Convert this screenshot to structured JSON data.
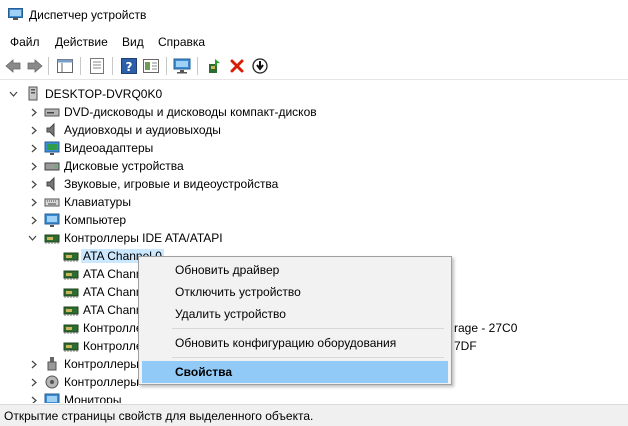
{
  "window": {
    "title": "Диспетчер устройств"
  },
  "menu": {
    "items": [
      "Файл",
      "Действие",
      "Вид",
      "Справка"
    ]
  },
  "toolbar": {
    "buttons": [
      "back-icon",
      "forward-icon",
      "view-icon",
      "properties-icon",
      "help-icon",
      "view-resources-icon",
      "monitor-icon",
      "update-driver-icon",
      "uninstall-icon",
      "disable-icon"
    ]
  },
  "tree": {
    "root": "DESKTOP-DVRQ0K0",
    "categories": [
      "DVD-дисководы и дисководы компакт-дисков",
      "Аудиовходы и аудиовыходы",
      "Видеоадаптеры",
      "Дисковые устройства",
      "Звуковые, игровые и видеоустройства",
      "Клавиатуры",
      "Компьютер",
      "Контроллеры IDE ATA/ATAPI"
    ],
    "ide_children": [
      "ATA Channel 0",
      "ATA Chann",
      "ATA Chann",
      "ATA Chann",
      "Контролле",
      "Контролле"
    ],
    "ide_child_right_parts": [
      "rage - 27C0",
      "7DF"
    ],
    "after": [
      "Контроллеры",
      "Контроллеры",
      "Мониторы"
    ]
  },
  "context_menu": {
    "items": [
      "Обновить драйвер",
      "Отключить устройство",
      "Удалить устройство",
      "Обновить конфигурацию оборудования",
      "Свойства"
    ]
  },
  "status": {
    "text": "Открытие страницы свойств для выделенного объекта."
  },
  "colors": {
    "selection": "#cce8ff",
    "menu_highlight": "#91c9f7",
    "uninstall_red": "#d81e06"
  }
}
